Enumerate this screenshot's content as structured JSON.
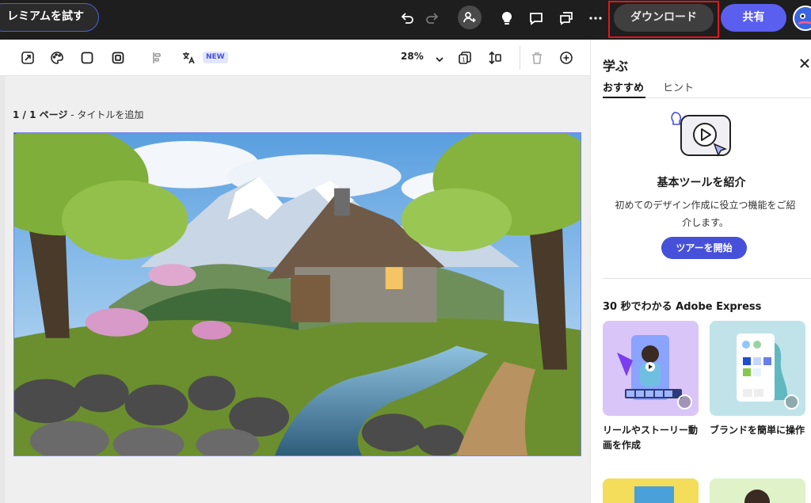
{
  "header": {
    "premium_label": "レミアムを試す",
    "download_label": "ダウンロード",
    "share_label": "共有",
    "icons": [
      "undo-icon",
      "redo-icon",
      "invite-user-icon",
      "lightbulb-icon",
      "comment-icon",
      "chat-bubbles-icon",
      "more-icon"
    ]
  },
  "toolbar": {
    "new_badge": "NEW",
    "zoom": "28%",
    "icons": [
      "resize-icon",
      "palette-icon",
      "square-icon",
      "frame-icon",
      "align-icon",
      "translate-icon",
      "chevron-down-icon",
      "pages-icon",
      "arrange-icon",
      "trash-icon",
      "add-icon"
    ]
  },
  "canvas": {
    "page_number": "1 / 1 ページ",
    "page_title_placeholder": " - タイトルを追加",
    "artwork_description_icon": "landscape-image"
  },
  "panel": {
    "title": "学ぶ",
    "tabs": [
      {
        "label": "おすすめ",
        "active": true
      },
      {
        "label": "ヒント",
        "active": false
      }
    ],
    "intro": {
      "title": "基本ツールを紹介",
      "description": "初めてのデザイン作成に役立つ機能をご紹介します。",
      "button": "ツアーを開始"
    },
    "section_title": "30 秒でわかる Adobe Express",
    "cards": [
      {
        "title": "リールやストーリー動画を作成"
      },
      {
        "title": "ブランドを簡単に操作"
      }
    ]
  },
  "colors": {
    "accent": "#4650d8",
    "share": "#5a5ff0",
    "highlight": "#e3151a",
    "topbar": "#1e1e1e"
  }
}
